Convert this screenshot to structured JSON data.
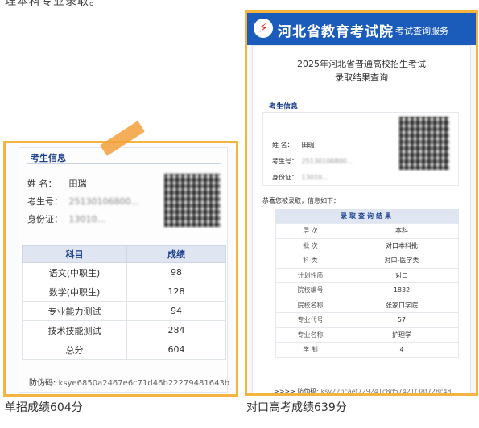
{
  "top_text": "理本科专业录取。",
  "left_card": {
    "section_title": "考生信息",
    "name_label": "姓  名：",
    "name_value": "田瑞",
    "exam_no_label": "考生号：",
    "exam_no_value": "25130106800...",
    "id_label": "身份证：",
    "id_value": "13010...",
    "table_headers": [
      "科目",
      "成绩"
    ],
    "rows": [
      {
        "subject": "语文(中职生)",
        "score": "98"
      },
      {
        "subject": "数学(中职生)",
        "score": "128"
      },
      {
        "subject": "专业能力测试",
        "score": "94"
      },
      {
        "subject": "技术技能测试",
        "score": "284"
      },
      {
        "subject": "总分",
        "score": "604"
      }
    ],
    "anti_fake_label": "防伪码:",
    "anti_fake_code": "ksye6850a2467e6c71d46b22279481643b"
  },
  "left_caption": "单招成绩604分",
  "right_card": {
    "banner_title": "河北省教育考试院",
    "banner_subtitle": "考试查询服务",
    "title_line1": "2025年河北省普通高校招生考试",
    "title_line2": "录取结果查询",
    "section_title": "考生信息",
    "name_label": "姓  名：",
    "name_value": "田瑞",
    "exam_no_label": "考生号：",
    "exam_no_value": "25130106800...",
    "id_label": "身份证：",
    "id_value": "13010...",
    "notice": "恭喜您被录取，信息如下：",
    "result_header": "录取查询结果",
    "results": [
      {
        "key": "层  次",
        "value": "本科"
      },
      {
        "key": "批  次",
        "value": "对口本科批"
      },
      {
        "key": "科  类",
        "value": "对口-医学类"
      },
      {
        "key": "计划性质",
        "value": "对口"
      },
      {
        "key": "院校编号",
        "value": "1832"
      },
      {
        "key": "院校名称",
        "value": "张家口学院"
      },
      {
        "key": "专业代号",
        "value": "57"
      },
      {
        "key": "专业名称",
        "value": "护理学"
      },
      {
        "key": "学  制",
        "value": "4"
      }
    ],
    "anti_fake_prefix": ">>>>",
    "anti_fake_label": "防伪码:",
    "anti_fake_code": "ksy22bcaef729241c8d57421f38f728c48"
  },
  "right_caption": "对口高考成绩639分",
  "colors": {
    "frame": "#f3b53f",
    "banner": "#1b5cba",
    "accent": "#1a3f8c"
  }
}
